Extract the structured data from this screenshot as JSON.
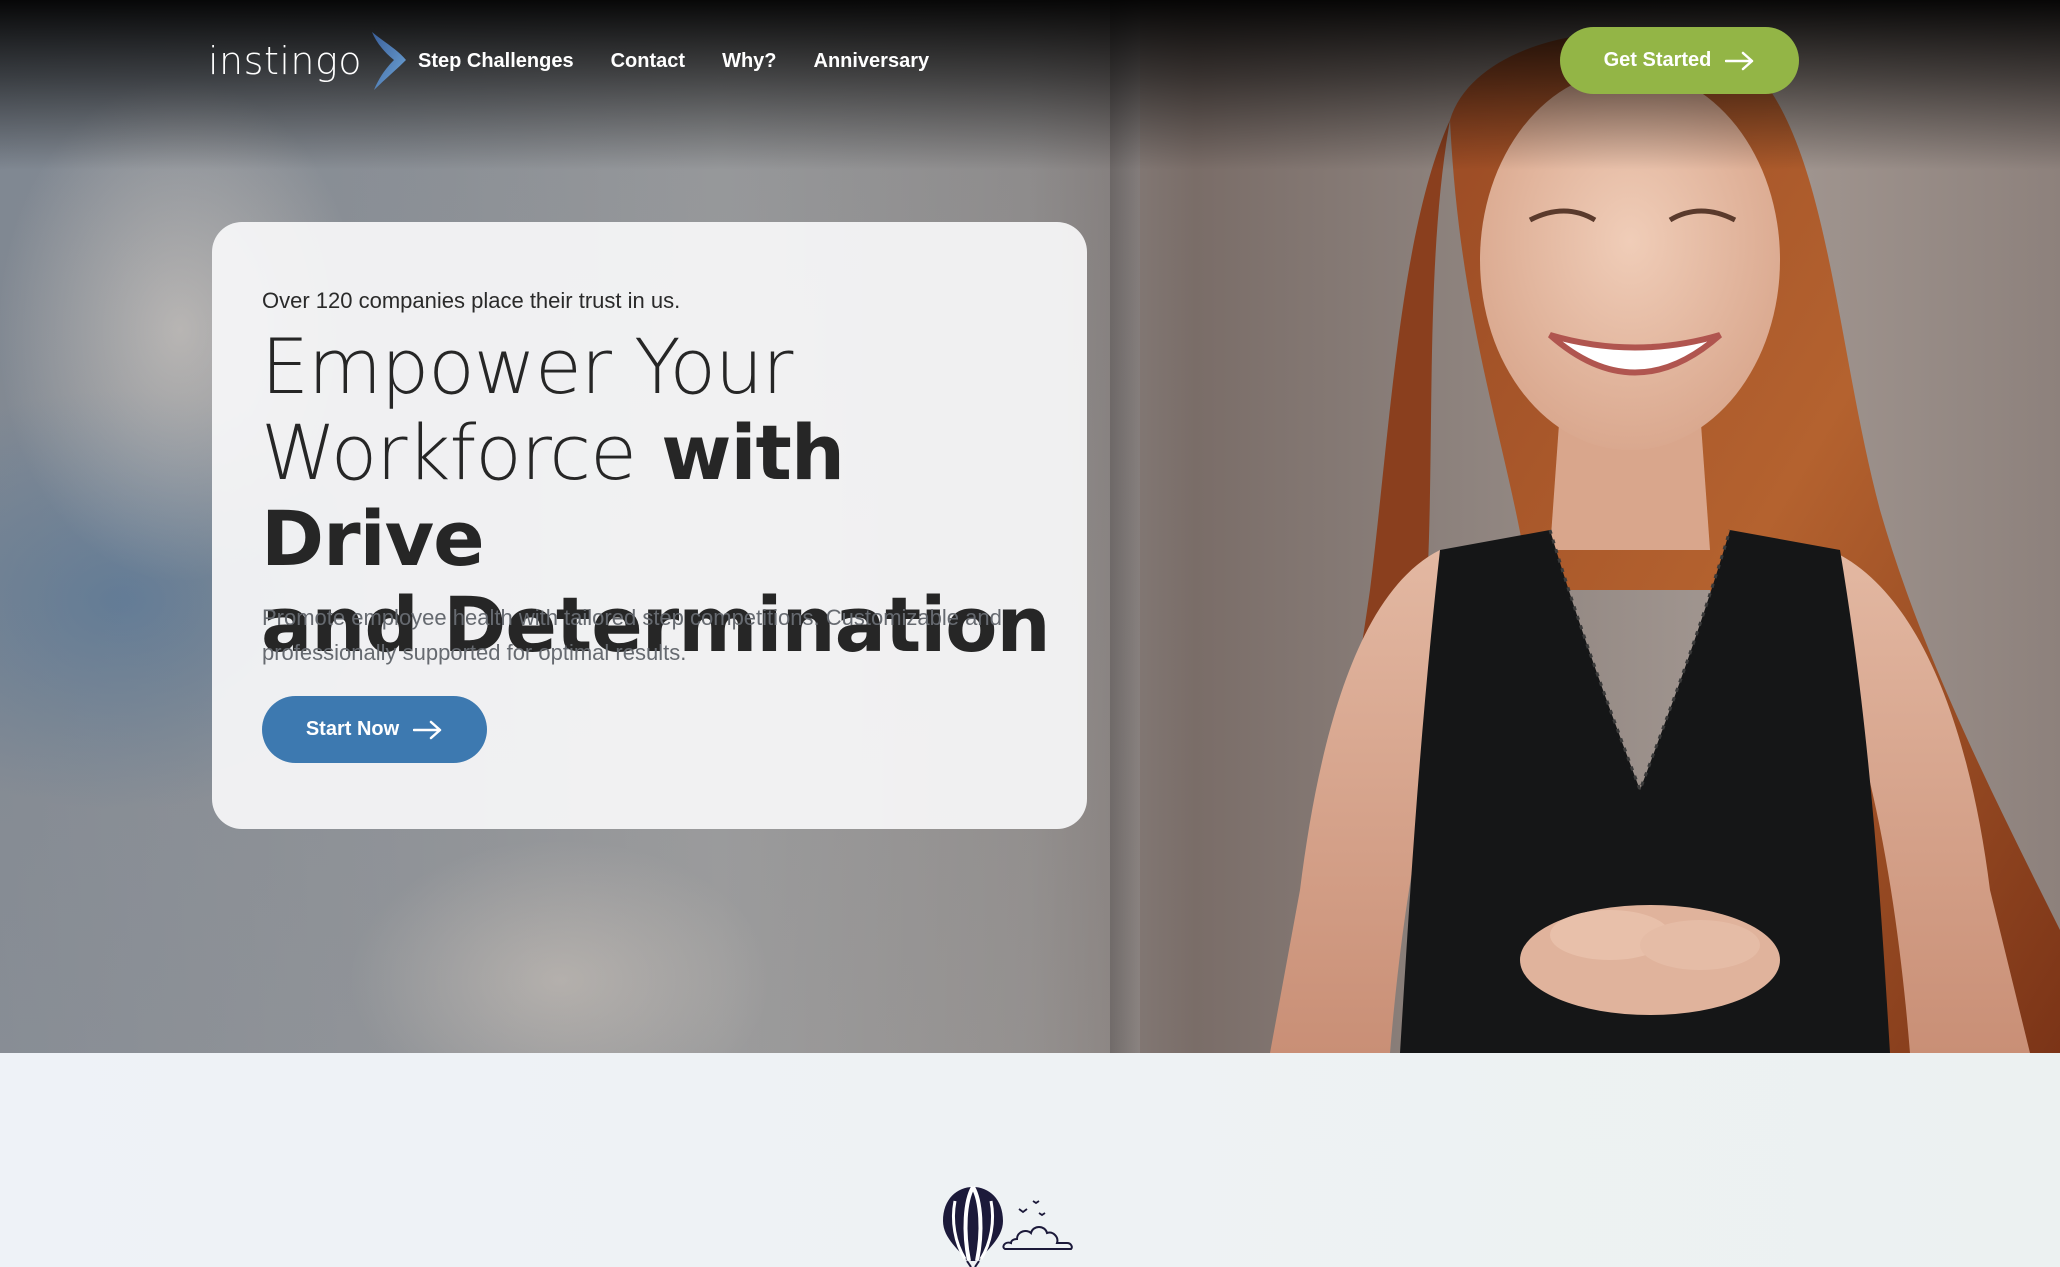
{
  "nav": {
    "logo_text": "instingo",
    "links": [
      {
        "label": "Step Challenges"
      },
      {
        "label": "Contact"
      },
      {
        "label": "Why?"
      },
      {
        "label": "Anniversary"
      }
    ],
    "cta_label": "Get Started",
    "cta_color": "#93b546"
  },
  "hero": {
    "eyebrow": "Over 120 companies place their trust in us.",
    "headline_light_1": "Empower Your",
    "headline_light_2": "Workforce",
    "headline_bold_1": "with Drive",
    "headline_bold_2": "and Determination",
    "description": "Promote employee health with tailored step competitions. Customizable and professionally supported for optimal results.",
    "cta_label": "Start Now",
    "cta_color": "#3d79b0"
  },
  "icons": {
    "logo_mark": "chevron-logo-icon",
    "cta_arrow": "arrow-right-icon",
    "illustration": "hot-air-balloon-icon"
  }
}
